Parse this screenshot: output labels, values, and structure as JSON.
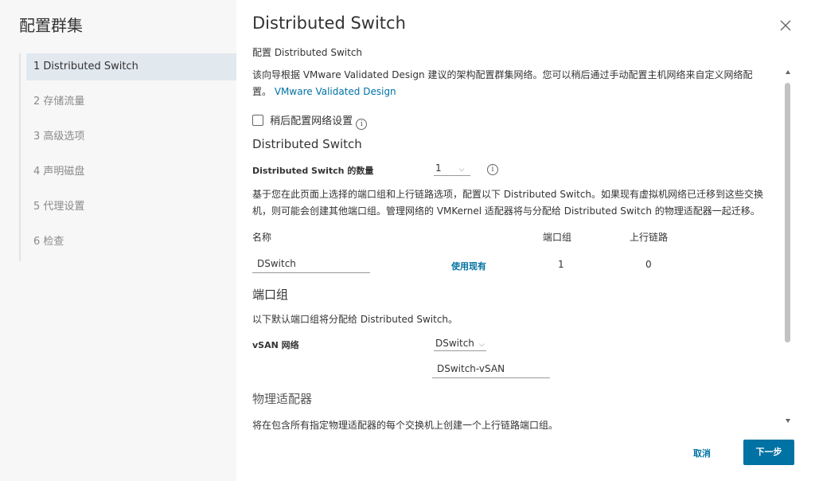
{
  "sidebar": {
    "title": "配置群集",
    "steps": [
      {
        "label": "1 Distributed Switch"
      },
      {
        "label": "2 存储流量"
      },
      {
        "label": "3 高级选项"
      },
      {
        "label": "4 声明磁盘"
      },
      {
        "label": "5 代理设置"
      },
      {
        "label": "6 检查"
      }
    ]
  },
  "header": {
    "title": "Distributed Switch",
    "subtitle": "配置 Distributed Switch"
  },
  "intro": {
    "line1": "该向导根据 VMware Validated Design 建议的架构配置群集网络。您可以稍后通过手动配置主机网络来自定义网络配",
    "line2_prefix": "置。",
    "link": "VMware Validated Design"
  },
  "config_later": {
    "label": "稍后配置网络设置"
  },
  "ds_section": {
    "heading": "Distributed Switch",
    "count_label": "Distributed Switch 的数量",
    "count_value": "1",
    "desc_line1": "基于您在此页面上选择的端口组和上行链路选项，配置以下 Distributed Switch。如果现有虚拟机网络已迁移到这些交换",
    "desc_line2": "机，则可能会创建其他端口组。管理网络的 VMKernel 适配器将与分配给 Distributed Switch 的物理适配器一起迁移。",
    "table": {
      "headers": {
        "name": "名称",
        "portgroups": "端口组",
        "uplinks": "上行链路"
      },
      "rows": [
        {
          "name": "DSwitch",
          "action": "使用现有",
          "portgroups": "1",
          "uplinks": "0"
        }
      ]
    }
  },
  "portgroup_section": {
    "heading": "端口组",
    "desc": "以下默认端口组将分配给 Distributed Switch。",
    "vsan_label": "vSAN 网络",
    "vsan_switch": "DSwitch",
    "vsan_portgroup": "DSwitch-vSAN"
  },
  "adapter_section": {
    "heading": "物理适配器",
    "desc": "将在包含所有指定物理适配器的每个交换机上创建一个上行链路端口组。"
  },
  "footer": {
    "cancel": "取消",
    "next": "下一步"
  }
}
